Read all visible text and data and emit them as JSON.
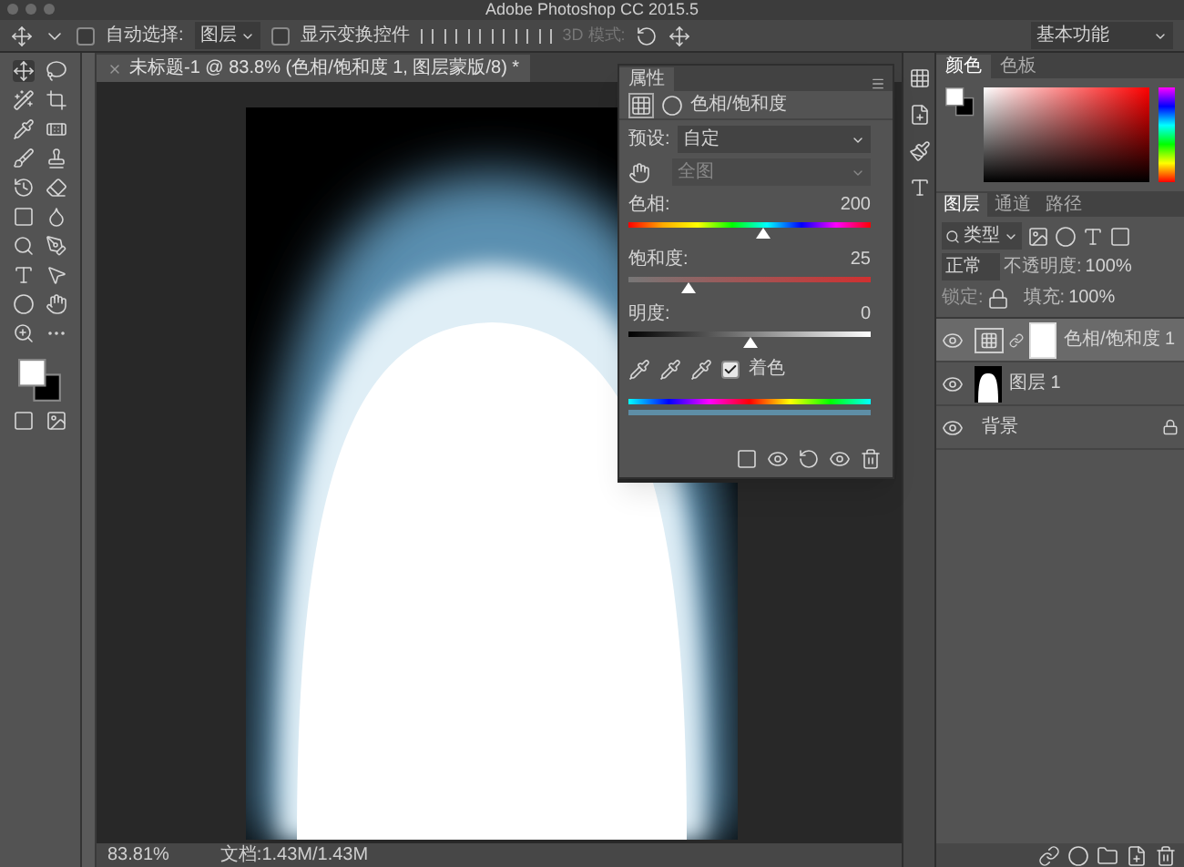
{
  "window": {
    "title": "Adobe Photoshop CC 2015.5"
  },
  "options_bar": {
    "auto_select": {
      "label": "自动选择:",
      "checked": false
    },
    "auto_select_target": "图层",
    "show_transform": {
      "label": "显示变换控件",
      "checked": false
    },
    "mode_3d": "3D 模式:",
    "workspace": "基本功能"
  },
  "document_tab": {
    "title": "未标题-1 @ 83.8% (色相/饱和度 1, 图层蒙版/8) *"
  },
  "properties_panel": {
    "tab": "属性",
    "title": "色相/饱和度",
    "preset_label": "预设:",
    "preset": "自定",
    "channel": "全图",
    "sliders": [
      {
        "label": "色相:",
        "value": "200",
        "level": 0.56,
        "kind": "hue"
      },
      {
        "label": "饱和度:",
        "value": "25",
        "level": 0.25,
        "kind": "saturation"
      },
      {
        "label": "明度:",
        "value": "0",
        "level": 0.5,
        "kind": "lightness"
      }
    ],
    "colorize": {
      "label": "着色",
      "checked": true
    }
  },
  "color_panel": {
    "tabs": [
      {
        "label": "颜色",
        "selected": true
      },
      {
        "label": "色板",
        "selected": false
      }
    ]
  },
  "layers_panel": {
    "tabs": [
      {
        "label": "图层",
        "selected": true
      },
      {
        "label": "通道",
        "selected": false
      },
      {
        "label": "路径",
        "selected": false
      }
    ],
    "filter": "类型",
    "blend_mode": "正常",
    "opacity_label": "不透明度:",
    "opacity": "100%",
    "lock_label": "锁定:",
    "fill_label": "填充:",
    "fill": "100%",
    "layers": [
      {
        "name": "色相/饱和度 1",
        "kind": "adjustment",
        "selected": true,
        "locked": false
      },
      {
        "name": "图层 1",
        "kind": "glow",
        "selected": false,
        "locked": false
      },
      {
        "name": "背景",
        "kind": "background",
        "selected": false,
        "locked": true
      }
    ]
  },
  "status_bar": {
    "zoom": "83.81%",
    "doc": "文档:1.43M/1.43M"
  }
}
